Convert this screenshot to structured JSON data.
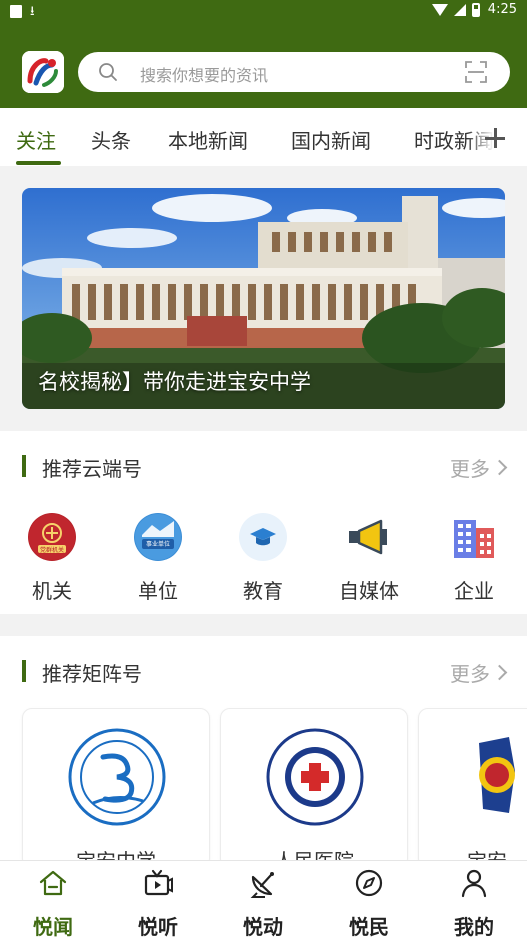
{
  "status_bar": {
    "time": "4:25"
  },
  "search": {
    "placeholder": "搜索你想要的资讯"
  },
  "tabs": [
    {
      "label": "关注",
      "active": true
    },
    {
      "label": "头条"
    },
    {
      "label": "本地新闻"
    },
    {
      "label": "国内新闻"
    },
    {
      "label": "时政新闻"
    }
  ],
  "banner": {
    "caption": "名校揭秘】带你走进宝安中学"
  },
  "yunduan": {
    "title": "推荐云端号",
    "more": "更多",
    "items": [
      {
        "label": "机关",
        "badge": "党群机关",
        "icon": "government-emblem-icon"
      },
      {
        "label": "单位",
        "badge": "事业单位",
        "icon": "institution-icon"
      },
      {
        "label": "教育",
        "icon": "graduation-cap-icon"
      },
      {
        "label": "自媒体",
        "icon": "megaphone-icon"
      },
      {
        "label": "企业",
        "icon": "building-icon"
      }
    ]
  },
  "juzhen": {
    "title": "推荐矩阵号",
    "more": "更多",
    "cards": [
      {
        "label": "宝安中学"
      },
      {
        "label": "人民医院"
      },
      {
        "label": "宝安"
      }
    ]
  },
  "bottom_nav": [
    {
      "label": "悦闻",
      "icon": "home-icon",
      "active": true
    },
    {
      "label": "悦听",
      "icon": "tv-icon"
    },
    {
      "label": "悦动",
      "icon": "satellite-dish-icon"
    },
    {
      "label": "悦民",
      "icon": "compass-icon"
    },
    {
      "label": "我的",
      "icon": "person-icon"
    }
  ],
  "colors": {
    "brand": "#3f6a12",
    "background": "#f2f2f2"
  }
}
